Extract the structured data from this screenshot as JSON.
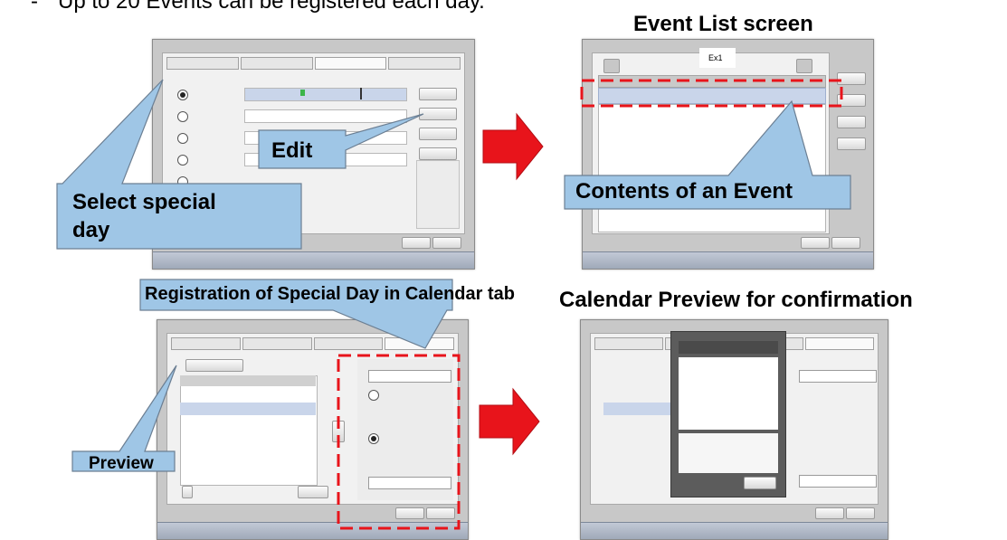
{
  "top_text": "Up to 20 Events can be registered each day.",
  "top_bullet": "-",
  "headings": {
    "event_list": "Event List screen",
    "calendar_preview": "Calendar Preview for confirmation"
  },
  "callouts": {
    "edit": "Edit",
    "select_special_day_line1": "Select special",
    "select_special_day_line2": "day",
    "contents_of_event": "Contents of an Event",
    "registration": "Registration of Special Day in Calendar tab",
    "preview": "Preview"
  },
  "screen_labels": {
    "ex1": "Ex1"
  },
  "colors": {
    "callout_fill": "#9fc6e6",
    "callout_stroke": "#6c7f93",
    "arrow_red": "#e8141b",
    "dash_red": "#e8141b"
  }
}
